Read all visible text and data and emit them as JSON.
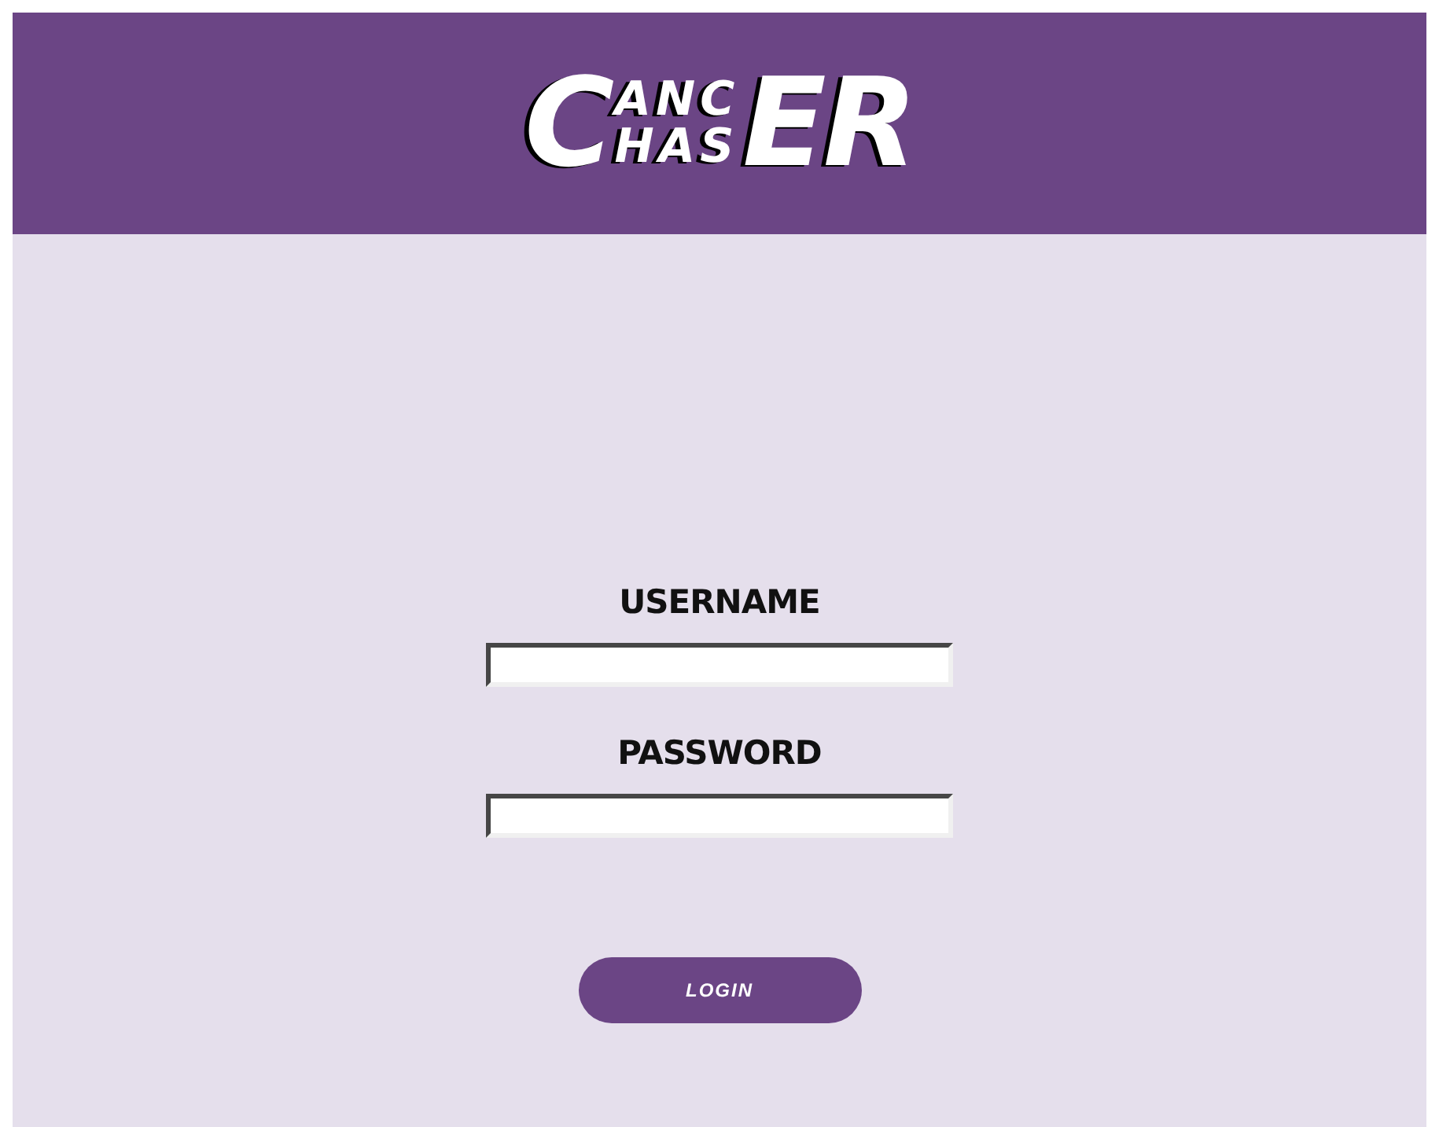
{
  "logo": {
    "first": "C",
    "top": "ANC",
    "bottom": "HAS",
    "last": "ER"
  },
  "fields": [
    {
      "label": "USERNAME"
    },
    {
      "label": "PASSWORD"
    }
  ],
  "button": "LOGIN"
}
